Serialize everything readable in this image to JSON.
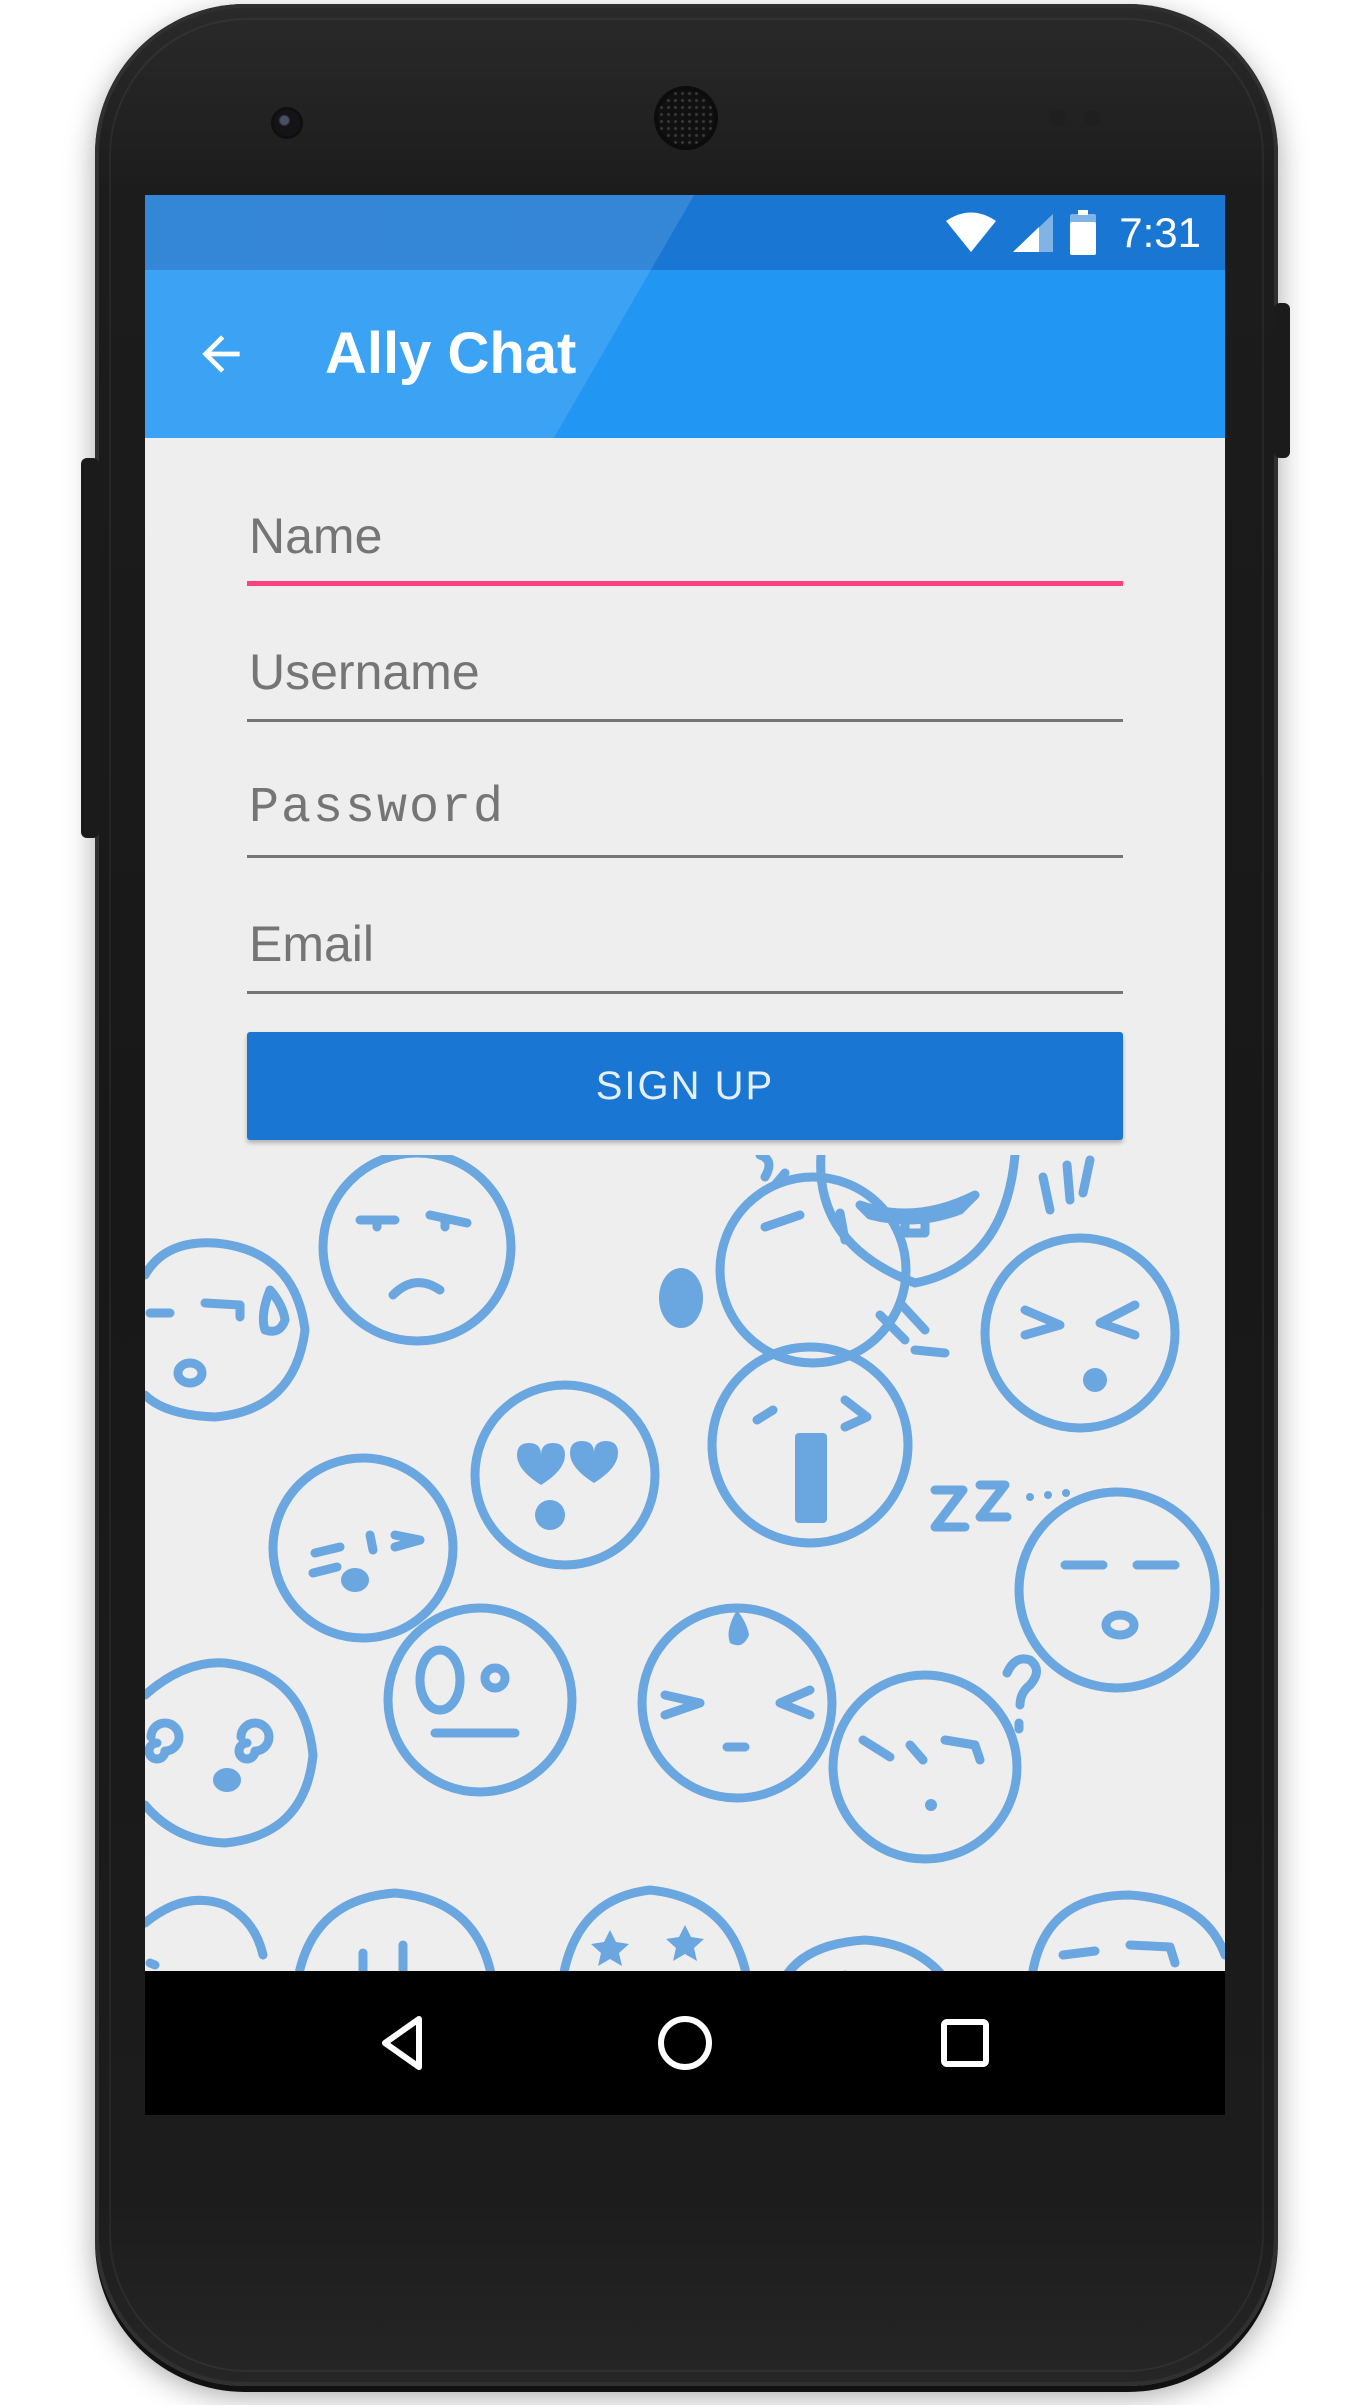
{
  "status_bar": {
    "time": "7:31",
    "icons": [
      "wifi-icon",
      "signal-icon",
      "battery-icon"
    ]
  },
  "app_bar": {
    "back_icon": "arrow-back-icon",
    "title": "Ally Chat"
  },
  "form": {
    "name_placeholder": "Name",
    "username_placeholder": "Username",
    "password_placeholder": "Password",
    "email_placeholder": "Email",
    "signup_label": "SIGN UP"
  },
  "background": {
    "illustration": "emoji-doodles-illustration"
  },
  "nav_bar": {
    "icons": [
      "back-triangle-icon",
      "home-circle-icon",
      "recents-square-icon"
    ]
  },
  "colors": {
    "status_bar": "#1976d2",
    "app_bar": "#2196f3",
    "accent": "#ff4081",
    "button": "#1976d2",
    "doodle": "#6aa6e0",
    "screen_background": "#eeeeee"
  }
}
